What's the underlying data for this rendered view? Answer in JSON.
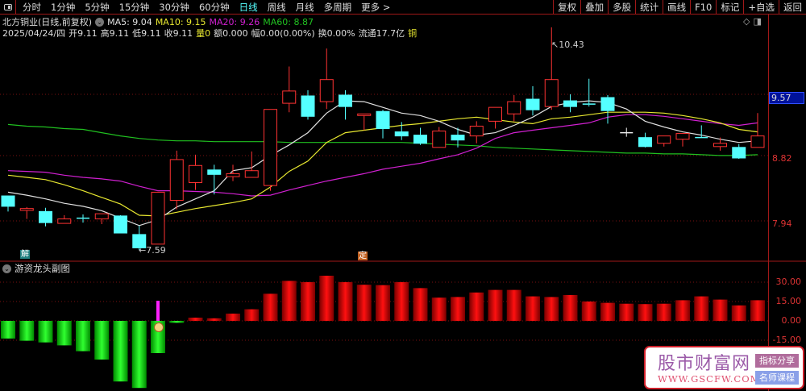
{
  "topbar": {
    "tabs": [
      "分时",
      "1分钟",
      "5分钟",
      "15分钟",
      "30分钟",
      "60分钟",
      "日线",
      "周线",
      "月线",
      "多周期",
      "更多 >"
    ],
    "active_tab": "日线",
    "buttons": [
      "复权",
      "叠加",
      "多股",
      "统计",
      "画线",
      "F10",
      "标记",
      "+自选",
      "返回"
    ]
  },
  "info": {
    "title": "北方铜业(日线,前复权)",
    "ma5": "MA5: 9.04",
    "ma10": "MA10: 9.15",
    "ma20": "MA20: 9.26",
    "ma60": "MA60: 8.87",
    "date": "2025/04/24/四",
    "open": "开9.11",
    "high": "高9.11",
    "low": "低9.11",
    "close": "收9.11",
    "volume": "量0",
    "amount": "额0.000",
    "change": "幅0.00(0.00%)",
    "turnover": "换0.00%",
    "float": "流通17.7亿",
    "sector": "铜"
  },
  "colors": {
    "up": "#ff3232",
    "down": "#54ffff",
    "ma5": "#e0e0e0",
    "ma10": "#e8e830",
    "ma20": "#d020d0",
    "ma60": "#20c020"
  },
  "price_axis": {
    "labels": [
      "9.57",
      "8.82",
      "7.94"
    ]
  },
  "annotations": {
    "low": "7.59",
    "high": "10.43",
    "badge_left": "解",
    "badge_right": "定"
  },
  "sub_chart": {
    "title": "游资龙头副图",
    "axis_labels": [
      "30.00",
      "15.00",
      "0.00",
      "-15.00"
    ],
    "values": [
      -13.7,
      -15.4,
      -16.7,
      -19,
      -23.5,
      -30,
      -47,
      -52,
      -25,
      -1.5,
      2.5,
      2,
      5.6,
      9,
      21,
      31,
      30,
      35,
      30,
      28,
      27.7,
      30,
      25.4,
      18,
      18.5,
      22,
      24,
      24,
      19,
      18.5,
      20,
      15,
      14,
      13.3,
      13,
      13.3,
      16,
      19,
      16.5,
      12,
      16
    ],
    "signal_index": 8,
    "signal_value": 15.6
  },
  "chart_data": {
    "type": "candlestick",
    "ylim": [
      7.4,
      10.6
    ],
    "candles": [
      [
        8.32,
        8.32,
        8.11,
        8.18
      ],
      [
        8.125,
        8.17,
        8.01,
        8.15
      ],
      [
        8.11,
        8.16,
        7.91,
        7.96
      ],
      [
        7.95,
        8.06,
        7.95,
        8.01
      ],
      [
        8.02,
        8.07,
        7.96,
        8.01
      ],
      [
        8.01,
        8.08,
        7.94,
        8.08
      ],
      [
        8.05,
        8.06,
        7.82,
        7.82
      ],
      [
        7.8,
        7.92,
        7.59,
        7.62
      ],
      [
        7.67,
        8.37,
        7.67,
        8.37
      ],
      [
        8.26,
        8.92,
        8.14,
        8.81
      ],
      [
        8.5,
        8.87,
        8.4,
        8.73
      ],
      [
        8.67,
        8.74,
        8.34,
        8.61
      ],
      [
        8.58,
        8.74,
        8.52,
        8.62
      ],
      [
        8.57,
        8.91,
        8.57,
        8.66
      ],
      [
        8.46,
        9.425,
        8.39,
        9.425
      ],
      [
        9.5,
        9.95,
        9.39,
        9.65
      ],
      [
        9.59,
        9.66,
        9.3,
        9.34
      ],
      [
        9.52,
        10.17,
        9.43,
        9.79
      ],
      [
        9.6,
        9.66,
        9.3,
        9.46
      ],
      [
        9.35,
        9.37,
        9.17,
        9.37
      ],
      [
        9.4,
        9.42,
        9.07,
        9.19
      ],
      [
        9.15,
        9.27,
        9.05,
        9.1
      ],
      [
        9.11,
        9.2,
        8.99,
        9.01
      ],
      [
        8.96,
        9.21,
        8.96,
        9.16
      ],
      [
        9.11,
        9.2,
        8.96,
        9.05
      ],
      [
        9.1,
        9.28,
        9.01,
        9.22
      ],
      [
        9.28,
        9.45,
        9.19,
        9.45
      ],
      [
        9.37,
        9.6,
        9.28,
        9.52
      ],
      [
        9.55,
        9.71,
        9.35,
        9.42
      ],
      [
        9.46,
        10.43,
        9.42,
        9.79
      ],
      [
        9.53,
        9.61,
        9.39,
        9.46
      ],
      [
        9.49,
        9.8,
        9.46,
        9.48
      ],
      [
        9.57,
        9.6,
        9.25,
        9.41
      ],
      [
        9.14,
        9.2,
        9.09,
        9.14
      ],
      [
        9.08,
        9.14,
        8.96,
        8.97
      ],
      [
        9.01,
        9.1,
        8.97,
        9.1
      ],
      [
        9.06,
        9.13,
        8.97,
        9.13
      ],
      [
        9.08,
        9.23,
        9.07,
        9.07
      ],
      [
        8.97,
        9.08,
        8.92,
        9.01
      ],
      [
        8.96,
        9.0,
        8.82,
        8.83
      ],
      [
        8.96,
        9.38,
        8.96,
        9.1
      ]
    ],
    "candle_fields": [
      "open",
      "high",
      "low",
      "close"
    ],
    "ma5": [
      8.37,
      8.33,
      8.28,
      8.22,
      8.18,
      8.12,
      8.02,
      7.92,
      8.0,
      8.17,
      8.28,
      8.39,
      8.66,
      8.7,
      8.86,
      8.99,
      9.14,
      9.38,
      9.53,
      9.52,
      9.45,
      9.38,
      9.35,
      9.28,
      9.18,
      9.11,
      9.14,
      9.23,
      9.33,
      9.46,
      9.51,
      9.53,
      9.51,
      9.43,
      9.28,
      9.21,
      9.15,
      9.11,
      9.06,
      9.02,
      9.04
    ],
    "ma10": [
      8.6,
      8.57,
      8.54,
      8.47,
      8.39,
      8.3,
      8.21,
      8.06,
      8.05,
      8.1,
      8.15,
      8.19,
      8.23,
      8.28,
      8.44,
      8.65,
      8.79,
      9.02,
      9.14,
      9.17,
      9.2,
      9.23,
      9.25,
      9.28,
      9.31,
      9.33,
      9.3,
      9.27,
      9.25,
      9.31,
      9.33,
      9.36,
      9.39,
      9.39,
      9.39,
      9.38,
      9.35,
      9.31,
      9.26,
      9.18,
      9.15
    ],
    "ma20": [
      8.66,
      8.65,
      8.64,
      8.6,
      8.57,
      8.55,
      8.52,
      8.45,
      8.39,
      8.39,
      8.38,
      8.37,
      8.35,
      8.32,
      8.33,
      8.4,
      8.46,
      8.52,
      8.57,
      8.62,
      8.68,
      8.72,
      8.76,
      8.82,
      8.87,
      8.95,
      9.07,
      9.14,
      9.17,
      9.2,
      9.23,
      9.26,
      9.33,
      9.36,
      9.36,
      9.34,
      9.31,
      9.28,
      9.25,
      9.23,
      9.26
    ],
    "ma60": [
      9.24,
      9.22,
      9.21,
      9.19,
      9.18,
      9.14,
      9.1,
      9.07,
      9.05,
      9.04,
      9.04,
      9.03,
      9.03,
      9.03,
      9.03,
      9.02,
      9.02,
      9.02,
      9.02,
      9.02,
      9.02,
      9.02,
      9.01,
      9.0,
      8.99,
      8.98,
      8.96,
      8.95,
      8.94,
      8.93,
      8.92,
      8.91,
      8.9,
      8.89,
      8.89,
      8.88,
      8.88,
      8.87,
      8.86,
      8.86,
      8.87
    ]
  }
}
